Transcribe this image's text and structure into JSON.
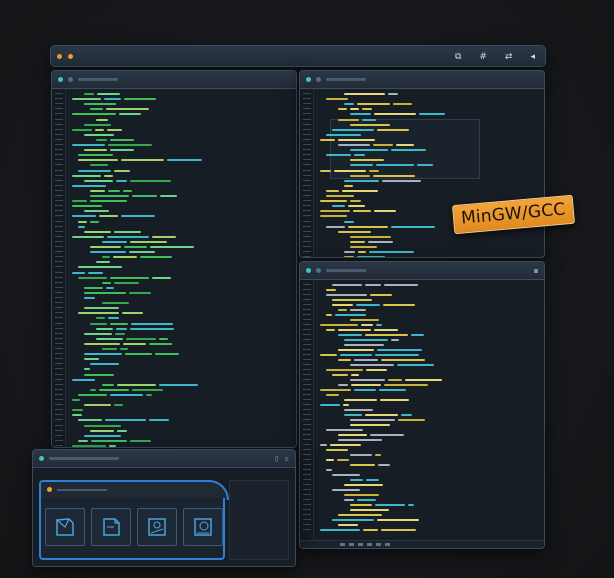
{
  "badge": {
    "label": "MinGW/GCC"
  },
  "colors": {
    "background": "#16181b",
    "accent": "#2f7fd6",
    "code_green": "#3fbf5a",
    "code_yellow": "#d8c64a",
    "code_cyan": "#3cb8c8",
    "badge": "#f0a035"
  },
  "main_toolbar": {
    "left_icons": [
      "orange-dot",
      "orange-dot"
    ],
    "right_icons": [
      "split-view-icon",
      "hash-icon",
      "branch-icon",
      "arrow-icon"
    ]
  },
  "editors": [
    {
      "name": "left-editor",
      "theme": "green"
    },
    {
      "name": "top-right-editor",
      "theme": "yellow"
    },
    {
      "name": "bottom-right-editor",
      "theme": "yellow"
    }
  ],
  "explorer": {
    "file_icons": [
      "document-icon",
      "document-icon",
      "image-file-icon",
      "image-file-icon"
    ]
  }
}
